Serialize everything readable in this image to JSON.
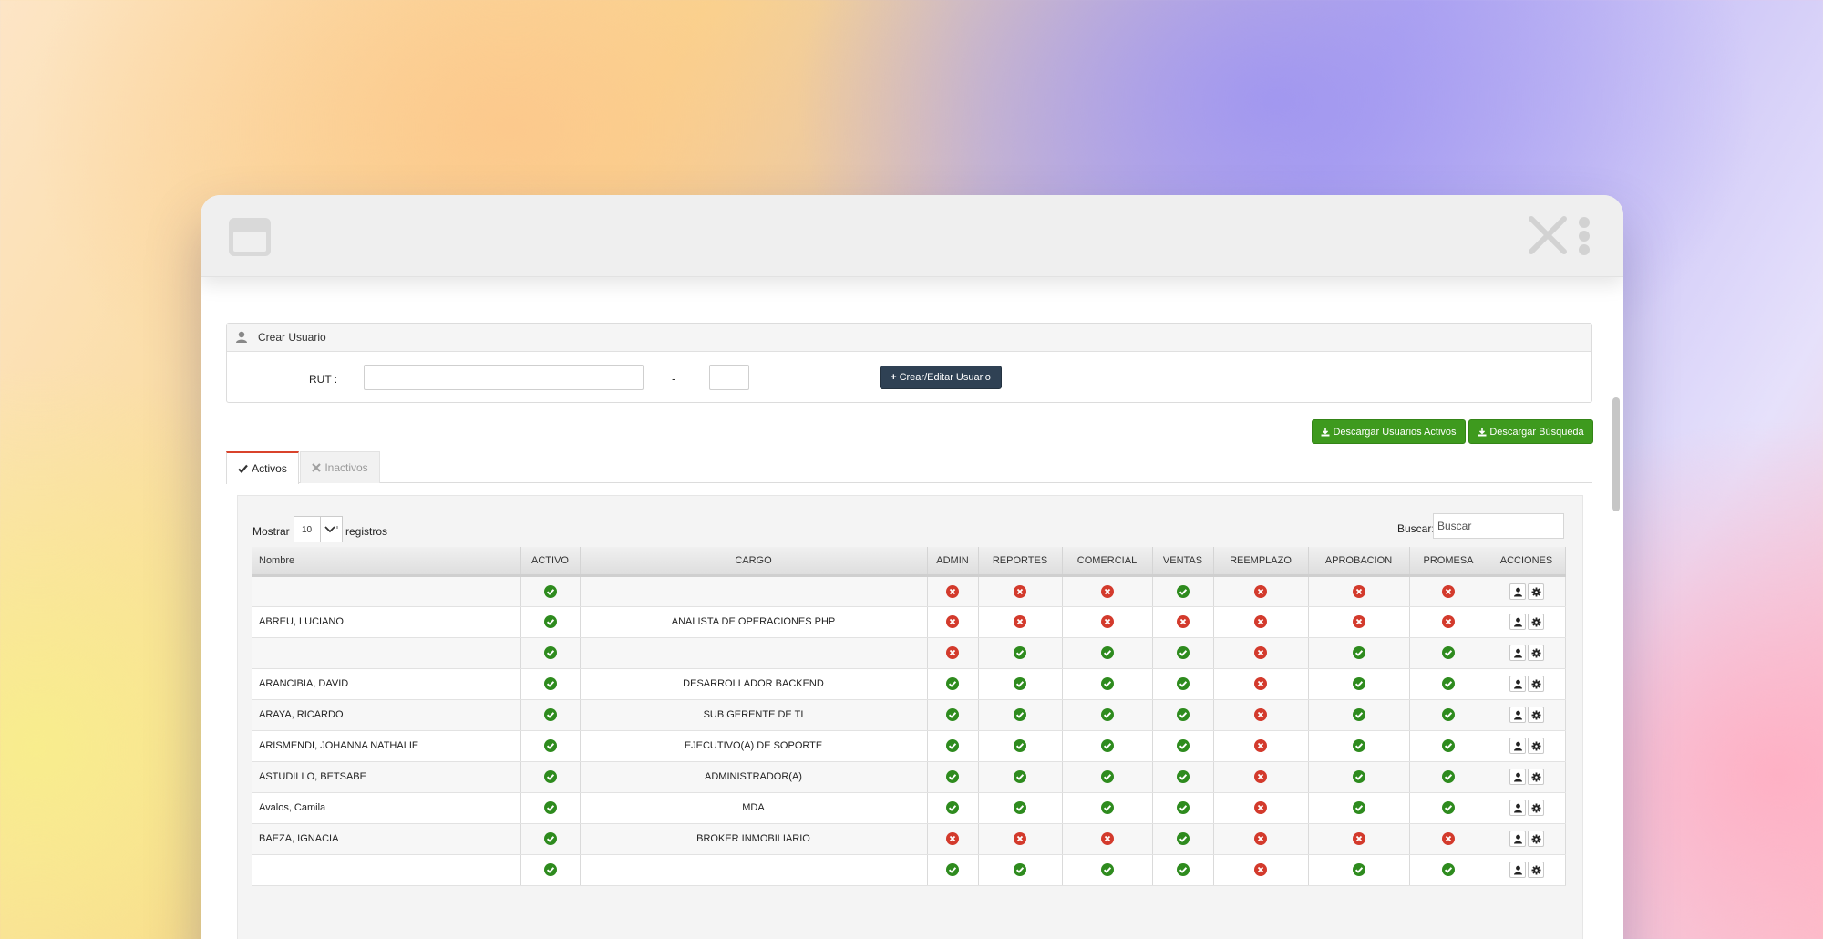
{
  "panel": {
    "title": "Crear Usuario"
  },
  "form": {
    "rut_label": "RUT :",
    "rut_value": "",
    "separator": "-",
    "dv_value": "",
    "create_button": "Crear/Editar Usuario"
  },
  "downloads": {
    "active_users": "Descargar Usuarios Activos",
    "search": "Descargar Búsqueda"
  },
  "tabs": [
    {
      "label": "Activos",
      "active": true,
      "icon": "check-icon"
    },
    {
      "label": "Inactivos",
      "active": false,
      "icon": "x-icon"
    }
  ],
  "table_controls": {
    "show_label": "Mostrar",
    "page_length": "10",
    "records_label": "registros",
    "search_label": "Buscar:",
    "search_placeholder": "Buscar"
  },
  "colors": {
    "ok": "#2e8b1e",
    "no": "#d33a2c",
    "primary_button": "#2f4154",
    "success_button": "#3e9a1e",
    "active_tab_accent": "#d9432b"
  },
  "table": {
    "columns": [
      "Nombre",
      "ACTIVO",
      "CARGO",
      "ADMIN",
      "REPORTES",
      "COMERCIAL",
      "VENTAS",
      "REEMPLAZO",
      "APROBACION",
      "PROMESA",
      "ACCIONES"
    ],
    "rows": [
      {
        "nombre": "",
        "activo": true,
        "cargo": "",
        "perms": [
          false,
          false,
          false,
          true,
          false,
          false,
          false
        ]
      },
      {
        "nombre": "ABREU, LUCIANO",
        "activo": true,
        "cargo": "ANALISTA DE OPERACIONES PHP",
        "perms": [
          false,
          false,
          false,
          false,
          false,
          false,
          false
        ]
      },
      {
        "nombre": "",
        "activo": true,
        "cargo": "",
        "perms": [
          false,
          true,
          true,
          true,
          false,
          true,
          true
        ]
      },
      {
        "nombre": "ARANCIBIA, DAVID",
        "activo": true,
        "cargo": "DESARROLLADOR BACKEND",
        "perms": [
          true,
          true,
          true,
          true,
          false,
          true,
          true
        ]
      },
      {
        "nombre": "ARAYA, RICARDO",
        "activo": true,
        "cargo": "SUB GERENTE DE TI",
        "perms": [
          true,
          true,
          true,
          true,
          false,
          true,
          true
        ]
      },
      {
        "nombre": "ARISMENDI, JOHANNA NATHALIE",
        "activo": true,
        "cargo": "EJECUTIVO(A) DE SOPORTE",
        "perms": [
          true,
          true,
          true,
          true,
          false,
          true,
          true
        ]
      },
      {
        "nombre": "ASTUDILLO, BETSABE",
        "activo": true,
        "cargo": "ADMINISTRADOR(A)",
        "perms": [
          true,
          true,
          true,
          true,
          false,
          true,
          true
        ]
      },
      {
        "nombre": "Avalos, Camila",
        "activo": true,
        "cargo": "MDA",
        "perms": [
          true,
          true,
          true,
          true,
          false,
          true,
          true
        ]
      },
      {
        "nombre": "BAEZA, IGNACIA",
        "activo": true,
        "cargo": "BROKER INMOBILIARIO",
        "perms": [
          false,
          false,
          false,
          true,
          false,
          false,
          false
        ]
      },
      {
        "nombre": "",
        "activo": true,
        "cargo": "",
        "perms": [
          true,
          true,
          true,
          true,
          false,
          true,
          true
        ]
      }
    ]
  }
}
